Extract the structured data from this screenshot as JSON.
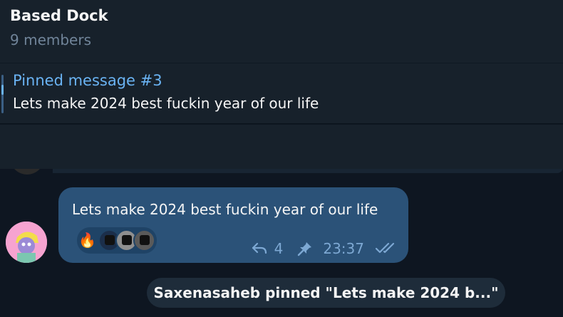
{
  "header": {
    "title": "Based Dock",
    "subtitle": "9 members"
  },
  "pinned": {
    "title": "Pinned message #3",
    "text": "Lets make 2024 best fuckin year of our life"
  },
  "message": {
    "text": "Lets make 2024 best fuckin year of our life",
    "reaction_emoji": "🔥",
    "reply_count": "4",
    "time": "23:37",
    "status_icon": "double-check-icon",
    "pinned_icon": "pin-icon"
  },
  "service_message": {
    "text": "Saxenasaheb pinned \"Lets make 2024 b...\""
  },
  "colors": {
    "background": "#0e1621",
    "panel": "#17212b",
    "bubble_out": "#2b5278",
    "accent": "#6ab3f3",
    "muted": "#708499"
  }
}
